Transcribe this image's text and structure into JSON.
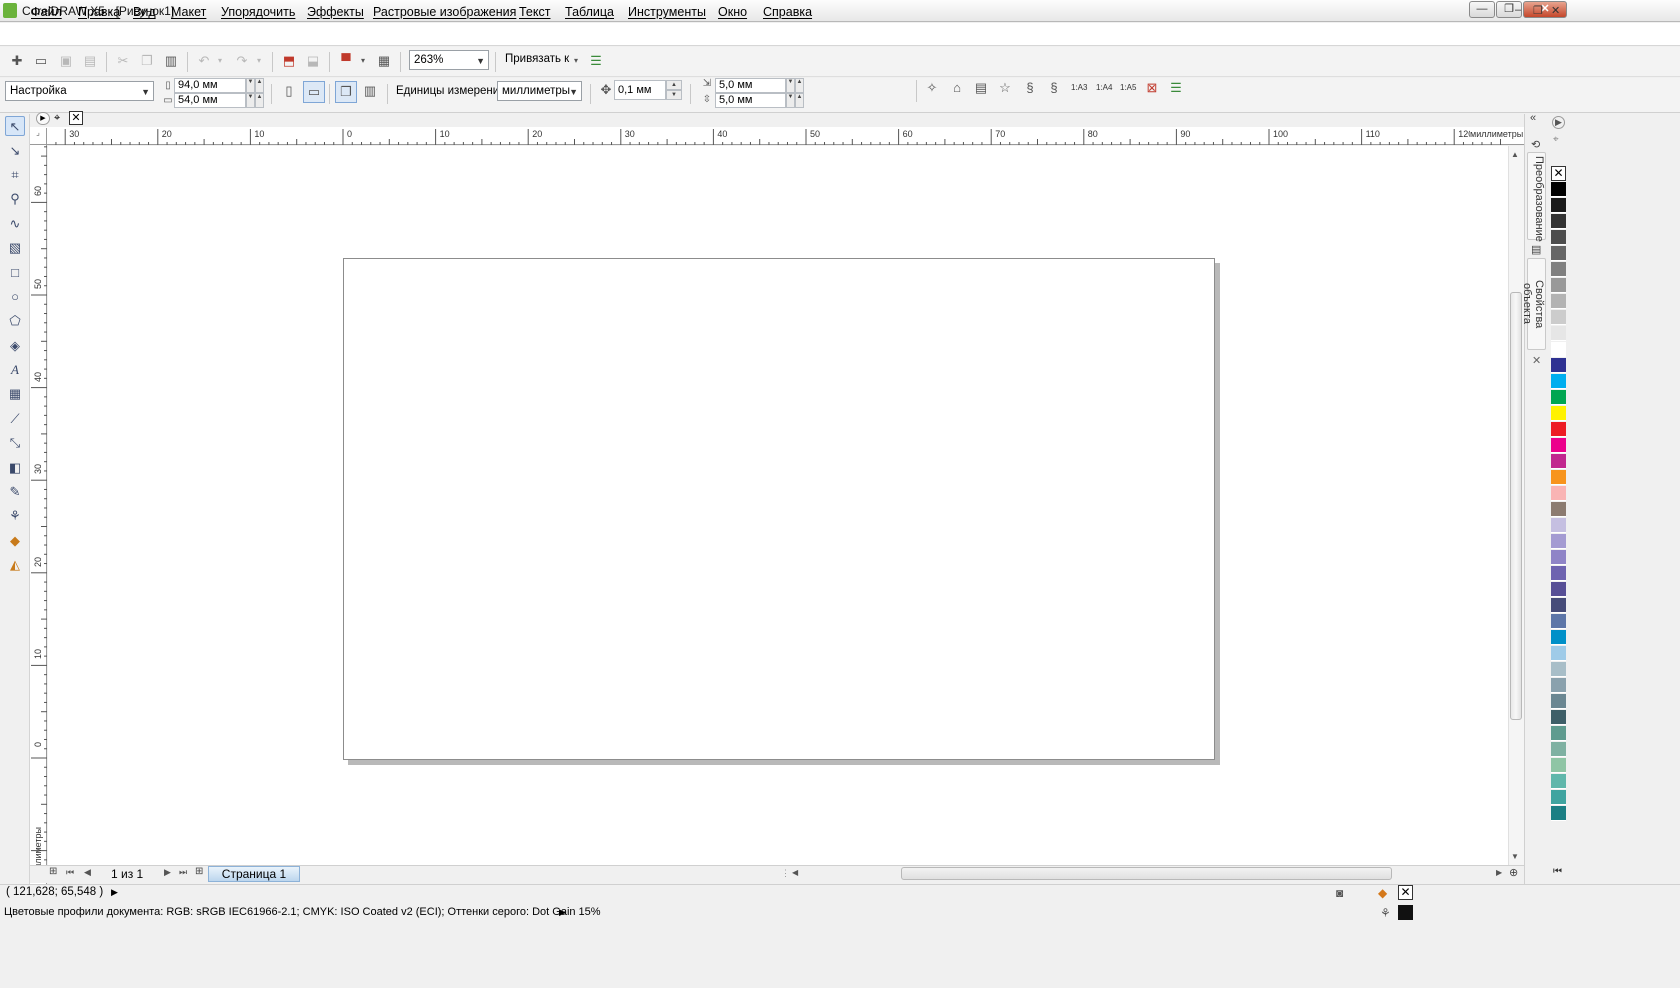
{
  "window": {
    "title": "CorelDRAW X5 - [Рисунок1]",
    "minimize": "—",
    "restore": "❐",
    "close": "✕"
  },
  "menu": [
    "Файл",
    "Правка",
    "Вид",
    "Макет",
    "Упорядочить",
    "Эффекты",
    "Растровые изображения",
    "Текст",
    "Таблица",
    "Инструменты",
    "Окно",
    "Справка"
  ],
  "doc_controls": [
    "–",
    "❐",
    "✕"
  ],
  "toolbar": {
    "zoom": "263%",
    "snap_label": "Привязать к"
  },
  "property_bar": {
    "preset": "Настройка",
    "width": "94,0 мм",
    "height": "54,0 мм",
    "units_label": "Единицы измерения:",
    "units": "миллиметры",
    "nudge": "0,1 мм",
    "dup_x": "5,0 мм",
    "dup_y": "5,0 мм",
    "labels": [
      "1:A3",
      "1:A4",
      "1:A5"
    ]
  },
  "ruler": {
    "unit": "миллиметры",
    "top_ticks": [
      "30",
      "20",
      "10",
      "0",
      "10",
      "20",
      "30",
      "40",
      "50",
      "60",
      "70",
      "80",
      "90",
      "100",
      "110",
      "120"
    ],
    "left_ticks": [
      "60",
      "50",
      "40",
      "30",
      "20",
      "10",
      "0"
    ]
  },
  "pager": {
    "page_count": "1 из 1",
    "page_tab": "Страница 1"
  },
  "dockers": [
    "Преобразование",
    "Свойства объекта"
  ],
  "status": {
    "coords": "( 121,628; 65,548 )",
    "profiles": "Цветовые профили документа: RGB: sRGB IEC61966-2.1; CMYK: ISO Coated v2 (ECI); Оттенки серого: Dot Gain 15%"
  },
  "palette": [
    "#000000",
    "#1a1a1a",
    "#333333",
    "#4d4d4d",
    "#666666",
    "#808080",
    "#999999",
    "#b3b3b3",
    "#cccccc",
    "#e6e6e6",
    "#ffffff",
    "#2e3192",
    "#00aeef",
    "#00a651",
    "#fff200",
    "#ed1c24",
    "#ec008c",
    "#c1278f",
    "#f7941d",
    "#f9b4b4",
    "#8c7b70",
    "#c5bfe1",
    "#a49bd2",
    "#8f84c7",
    "#6e63b0",
    "#574f96",
    "#464c79",
    "#5d76a8",
    "#0090c8",
    "#9fcbe8",
    "#a8bec8",
    "#8aa1ad",
    "#6b8792",
    "#3e5f68",
    "#5f9b8f",
    "#7fb1a2",
    "#8fc5a5",
    "#60b7ab",
    "#3fa4a0",
    "#1b7f84"
  ]
}
